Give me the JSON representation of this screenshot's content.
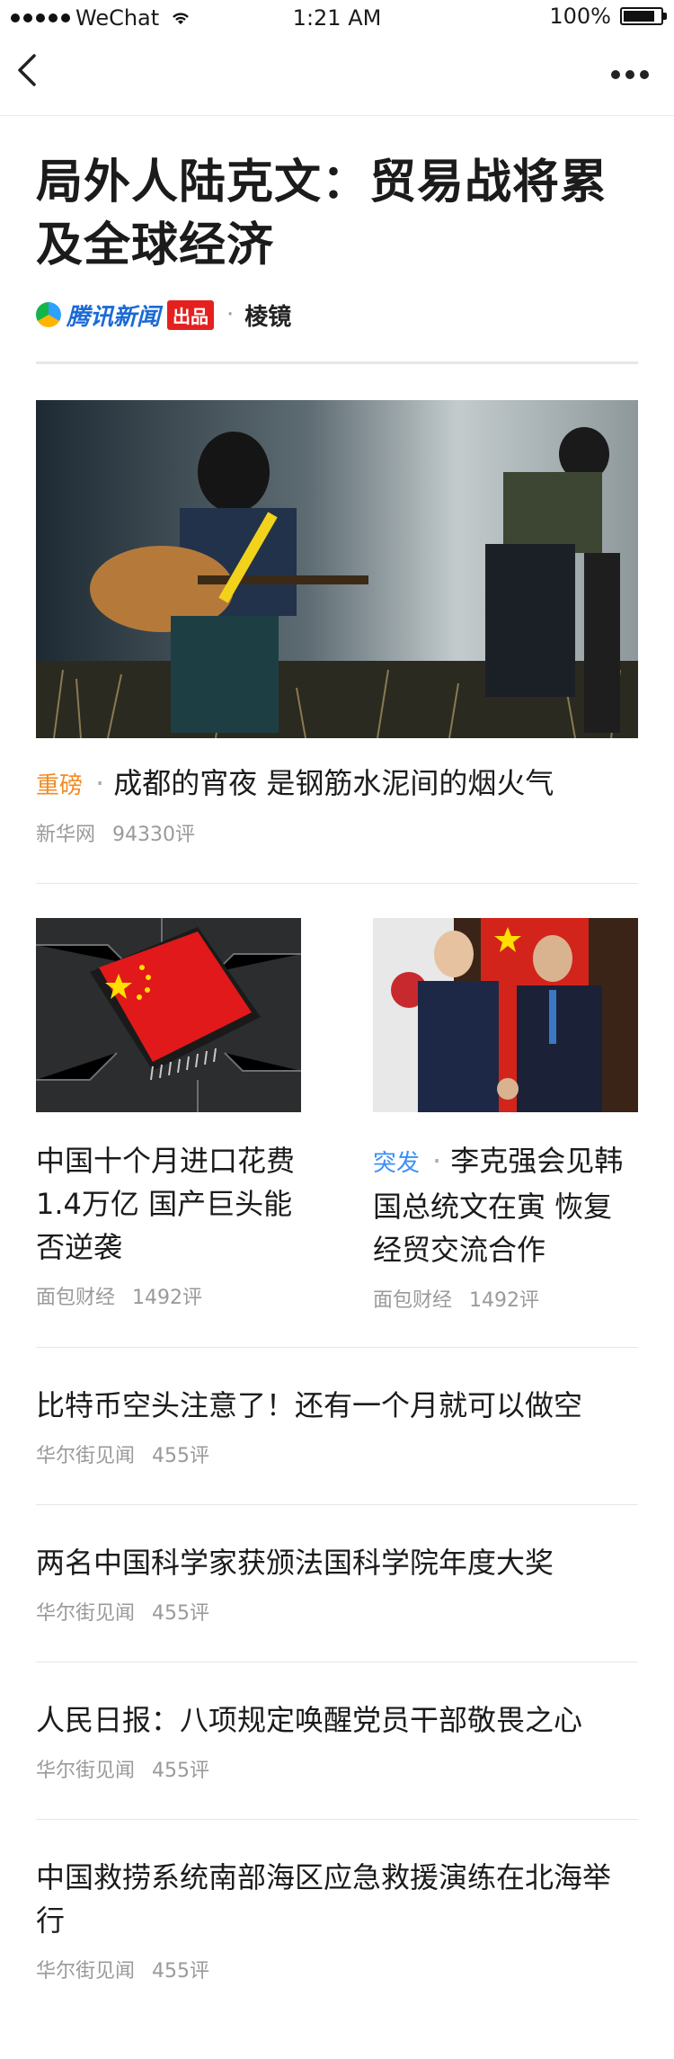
{
  "status_bar": {
    "carrier": "WeChat",
    "time": "1:21 AM",
    "battery": "100%"
  },
  "nav": {
    "back_icon": "chevron-left-icon",
    "more_icon": "more-horizontal-icon"
  },
  "article": {
    "title": "局外人陆克文：贸易战将累及全球经济",
    "source_brand": "腾讯新闻",
    "source_badge": "出品",
    "channel": "棱镜"
  },
  "hero_story": {
    "tag": "重磅",
    "title": "成都的宵夜 是钢筋水泥间的烟火气",
    "source": "新华网",
    "comments": "94330评"
  },
  "two_col": [
    {
      "tag": "",
      "title": "中国十个月进口花费1.4万亿 国产巨头能否逆袭",
      "source": "面包财经",
      "comments": "1492评"
    },
    {
      "tag": "突发",
      "title": "李克强会见韩国总统文在寅 恢复经贸交流合作",
      "source": "面包财经",
      "comments": "1492评"
    }
  ],
  "list": [
    {
      "title": "比特币空头注意了！还有一个月就可以做空",
      "source": "华尔街见闻",
      "comments": "455评"
    },
    {
      "title": "两名中国科学家获颁法国科学院年度大奖",
      "source": "华尔街见闻",
      "comments": "455评"
    },
    {
      "title": "人民日报：八项规定唤醒党员干部敬畏之心",
      "source": "华尔街见闻",
      "comments": "455评"
    },
    {
      "title": "中国救捞系统南部海区应急救援演练在北海举行",
      "source": "华尔街见闻",
      "comments": "455评"
    }
  ],
  "colors": {
    "tag_orange": "#f28a22",
    "tag_blue": "#3b8ff7",
    "brand_blue": "#1a6ad6",
    "badge_red": "#e4211f"
  }
}
